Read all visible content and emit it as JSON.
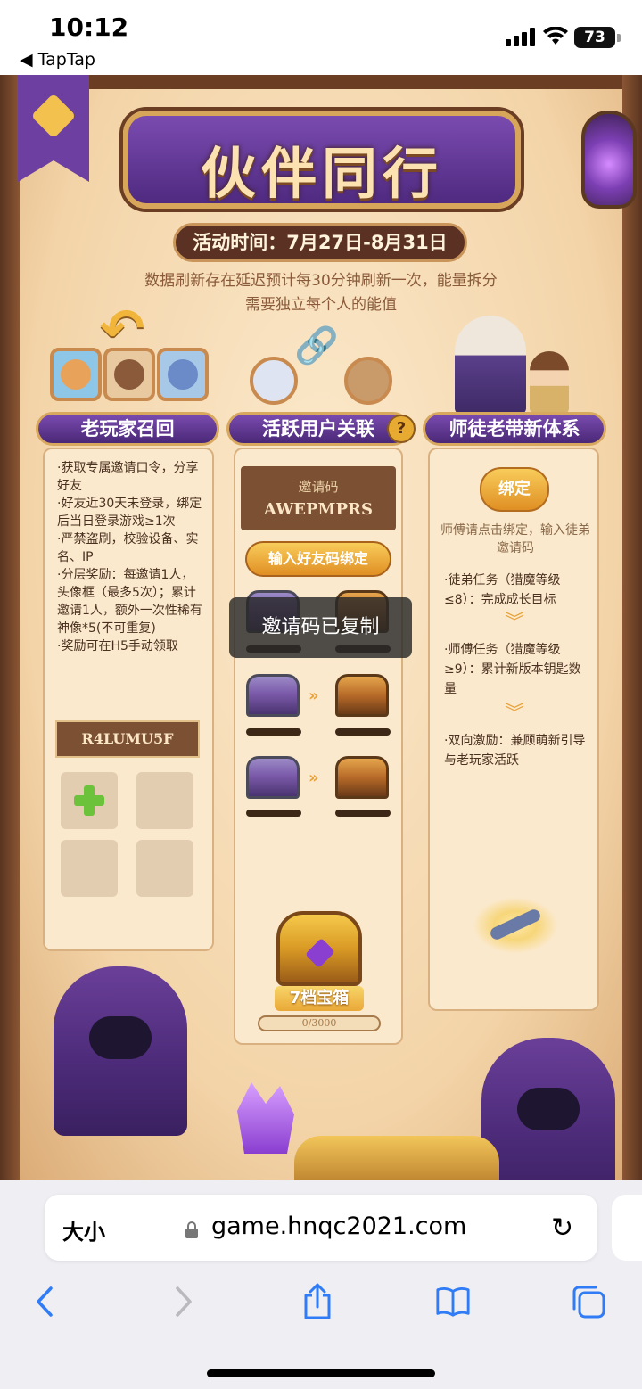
{
  "status_bar": {
    "time": "10:12",
    "back_app": "◀ TapTap",
    "battery": "73"
  },
  "game": {
    "title": "伙伴同行",
    "event_time": "活动时间：7月27日-8月31日",
    "notice": "数据刷新存在延迟预计每30分钟刷新一次，能量拆分需要独立每个人的能值",
    "sections": {
      "recall": {
        "header": "老玩家召回",
        "rules": [
          "·获取专属邀请口令，分享好友",
          "·好友近30天未登录，绑定后当日登录游戏≥1次",
          "·严禁盗刷，校验设备、实名、IP",
          "·分层奖励：每邀请1人，头像框（最多5次）；累计邀请1人，额外一次性稀有神像*5(不可重复)",
          "·奖励可在H5手动领取"
        ],
        "my_code": "R4LUMU5F"
      },
      "link": {
        "header": "活跃用户关联",
        "help": "?",
        "invite_label": "邀请码",
        "invite_code": "AWEPMPRS",
        "bind_button": "输入好友码绑定",
        "chest_label": "7档宝箱",
        "progress": "0/3000"
      },
      "mentor": {
        "header": "师徒老带新体系",
        "bind_button": "绑定",
        "hint": "师傅请点击绑定，输入徒弟邀请码",
        "tasks": [
          "·徒弟任务（猎魔等级≤8）：完成成长目标",
          "·师傅任务（猎魔等级≥9）：累计新版本钥匙数量",
          "·双向激励：兼顾萌新引导与老玩家活跃"
        ]
      }
    },
    "toast": "邀请码已复制"
  },
  "browser": {
    "text_size": "大小",
    "url": "game.hnqc2021.com"
  },
  "icons": {
    "back": "chevron-left-icon",
    "forward": "chevron-right-icon",
    "share": "share-icon",
    "bookmarks": "book-icon",
    "tabs": "tabs-icon",
    "reload": "reload-icon",
    "lock": "lock-icon"
  },
  "colors": {
    "accent": "#2f7cf6",
    "header_purple": "#6a3f9e",
    "gold_button": "#e9a837"
  }
}
